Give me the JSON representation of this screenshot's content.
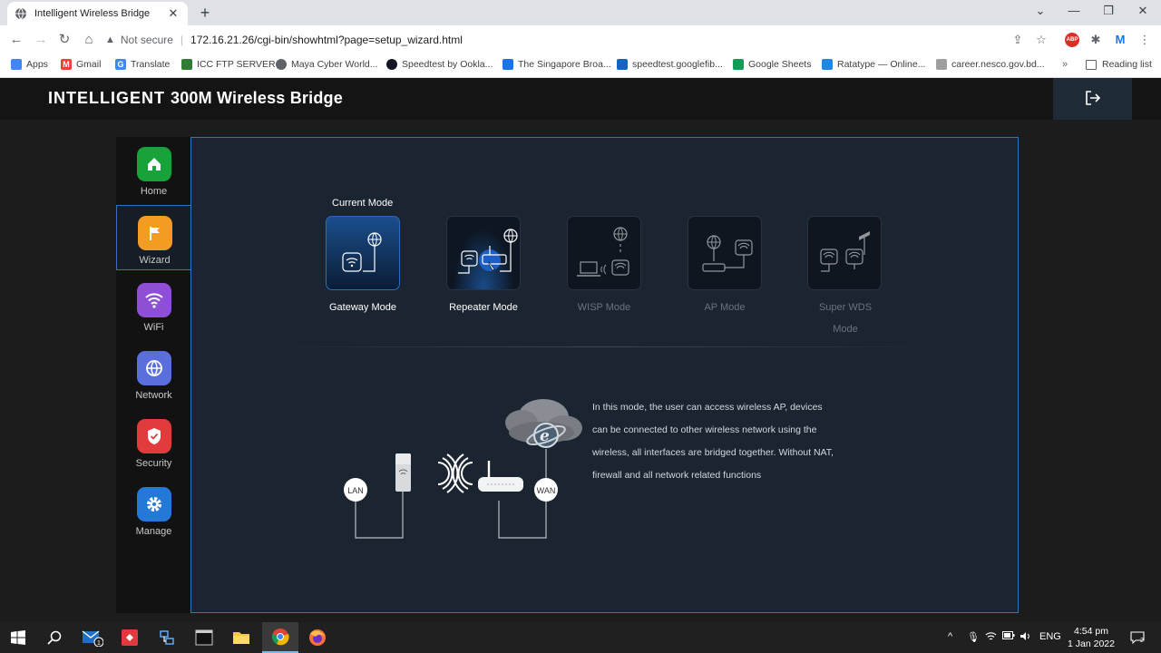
{
  "browser": {
    "tab_title": "Intelligent Wireless Bridge",
    "not_secure": "Not secure",
    "url": "172.16.21.26/cgi-bin/showhtml?page=setup_wizard.html",
    "bookmarks": [
      {
        "label": "Apps",
        "icon": "apps-grid-icon",
        "color": "#4285f4"
      },
      {
        "label": "Gmail",
        "icon": "gmail-icon",
        "color": "#ea4335"
      },
      {
        "label": "Translate",
        "icon": "translate-icon",
        "color": "#4285f4"
      },
      {
        "label": "ICC FTP SERVER",
        "icon": "ftp-icon",
        "color": "#2e7d32"
      },
      {
        "label": "Maya Cyber World...",
        "icon": "globe-icon",
        "color": "#5f6368"
      },
      {
        "label": "Speedtest by Ookla...",
        "icon": "speedtest-icon",
        "color": "#141526"
      },
      {
        "label": "The Singapore Broa...",
        "icon": "document-icon",
        "color": "#1a73e8"
      },
      {
        "label": "speedtest.googlefib...",
        "icon": "fiber-icon",
        "color": "#1565c0"
      },
      {
        "label": "Google Sheets",
        "icon": "sheets-icon",
        "color": "#0f9d58"
      },
      {
        "label": "Ratatype — Online...",
        "icon": "ratatype-icon",
        "color": "#1e88e5"
      },
      {
        "label": "career.nesco.gov.bd...",
        "icon": "page-icon",
        "color": "#9e9e9e"
      }
    ],
    "reading_list": "Reading list"
  },
  "router": {
    "brand_bold": "INTELLIGENT",
    "brand_rest": "300M Wireless Bridge",
    "sidebar": [
      {
        "label": "Home",
        "color": "#18a33a",
        "icon": "home-icon"
      },
      {
        "label": "Wizard",
        "color": "#f39c23",
        "icon": "flag-icon"
      },
      {
        "label": "WiFi",
        "color": "#8e4fd6",
        "icon": "wifi-icon"
      },
      {
        "label": "Network",
        "color": "#5b6fdc",
        "icon": "globe-icon"
      },
      {
        "label": "Security",
        "color": "#e23b3b",
        "icon": "shield-icon"
      },
      {
        "label": "Manage",
        "color": "#2478d8",
        "icon": "gear-icon"
      }
    ],
    "current_mode_label": "Current Mode",
    "modes": [
      {
        "label": "Gateway Mode",
        "state": "active"
      },
      {
        "label": "Repeater Mode",
        "state": "hover"
      },
      {
        "label": "WISP Mode",
        "state": "dim"
      },
      {
        "label": "AP Mode",
        "state": "dim"
      },
      {
        "label": "Super WDS Mode",
        "state": "dim"
      }
    ],
    "diagram": {
      "lan": "LAN",
      "wan": "WAN"
    },
    "description": "In this mode, the user can access wireless AP, devices can be connected to other wireless network using the wireless, all interfaces are bridged together. Without NAT, firewall and all network related functions"
  },
  "taskbar": {
    "mail_badge": "1",
    "lang": "ENG",
    "time": "4:54 pm",
    "date": "1 Jan 2022",
    "notifications": "2"
  }
}
